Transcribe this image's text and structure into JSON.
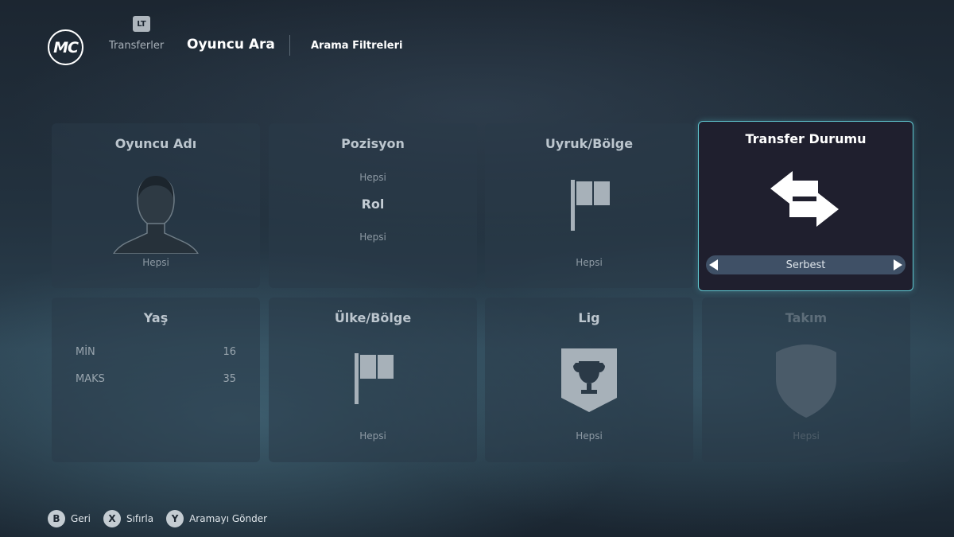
{
  "header": {
    "logo_text": "MC",
    "trigger_badge": "LT",
    "breadcrumb_prev": "Transferler",
    "breadcrumb_current": "Oyuncu Ara",
    "filters_label": "Arama Filtreleri"
  },
  "tiles": {
    "player_name": {
      "title": "Oyuncu Adı",
      "value": "Hepsi",
      "icon": "player-silhouette-icon"
    },
    "position": {
      "title": "Pozisyon",
      "value_top": "Hepsi",
      "value_mid": "Rol",
      "value_bottom": "Hepsi"
    },
    "nationality": {
      "title": "Uyruk/Bölge",
      "value": "Hepsi",
      "icon": "flag-icon"
    },
    "transfer_status": {
      "title": "Transfer Durumu",
      "value": "Serbest",
      "icon": "transfer-arrows-icon"
    },
    "age": {
      "title": "Yaş",
      "min_label": "MİN",
      "min_value": "16",
      "max_label": "MAKS",
      "max_value": "35"
    },
    "country": {
      "title": "Ülke/Bölge",
      "value": "Hepsi",
      "icon": "flag-icon"
    },
    "league": {
      "title": "Lig",
      "value": "Hepsi",
      "icon": "trophy-icon"
    },
    "team": {
      "title": "Takım",
      "value": "Hepsi",
      "icon": "crest-icon"
    }
  },
  "footer": {
    "back": {
      "key": "B",
      "label": "Geri"
    },
    "reset": {
      "key": "X",
      "label": "Sıfırla"
    },
    "submit": {
      "key": "Y",
      "label": "Aramayı Gönder"
    }
  },
  "colors": {
    "active_border": "#5fc7d0",
    "tile_bg": "#2a3a48",
    "active_tile_bg": "#1f1f2e",
    "selector_bg": "#3f5066"
  }
}
